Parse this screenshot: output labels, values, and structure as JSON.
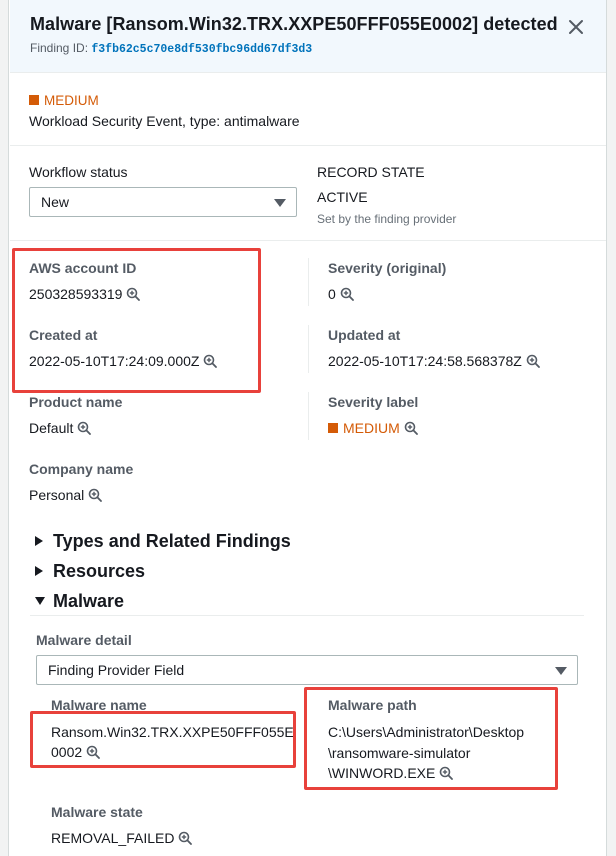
{
  "header": {
    "title": "Malware [Ransom.Win32.TRX.XXPE50FFF055E0002] detected",
    "finding_id_label": "Finding ID:",
    "finding_id": "f3fb62c5c70e8df530fbc96dd67df3d3",
    "close_icon": "close-icon"
  },
  "summary": {
    "severity": "MEDIUM",
    "severity_color": "#d45b07",
    "description": "Workload Security Event, type: antimalware"
  },
  "workflow": {
    "label": "Workflow status",
    "selected": "New"
  },
  "record_state": {
    "label": "RECORD STATE",
    "value": "ACTIVE",
    "note": "Set by the finding provider"
  },
  "fields": {
    "aws_account_id": {
      "label": "AWS account ID",
      "value": "250328593319"
    },
    "severity_original": {
      "label": "Severity (original)",
      "value": "0"
    },
    "created_at": {
      "label": "Created at",
      "value": "2022-05-10T17:24:09.000Z"
    },
    "updated_at": {
      "label": "Updated at",
      "value": "2022-05-10T17:24:58.568378Z"
    },
    "product_name": {
      "label": "Product name",
      "value": "Default"
    },
    "severity_label": {
      "label": "Severity label",
      "value": "MEDIUM"
    },
    "company_name": {
      "label": "Company name",
      "value": "Personal"
    }
  },
  "sections": {
    "types": "Types and Related Findings",
    "resources": "Resources",
    "malware": "Malware"
  },
  "malware": {
    "detail_label": "Malware detail",
    "detail_selected": "Finding Provider Field",
    "name_label": "Malware name",
    "name_line1": "Ransom.Win32.TRX.XXPE50FFF055E",
    "name_line2": "0002",
    "path_label": "Malware path",
    "path_line1": "C:\\Users\\Administrator\\Desktop",
    "path_line2": "\\ransomware-simulator",
    "path_line3": "\\WINWORD.EXE",
    "state_label": "Malware state",
    "state_value": "REMOVAL_FAILED"
  },
  "highlight_color": "#e8413b",
  "accent_link_color": "#0073bb",
  "icons": {
    "zoom": "zoom-in-icon",
    "caret": "caret-down-icon",
    "expand": "expand-triangle-icon",
    "collapse": "collapse-triangle-icon"
  }
}
